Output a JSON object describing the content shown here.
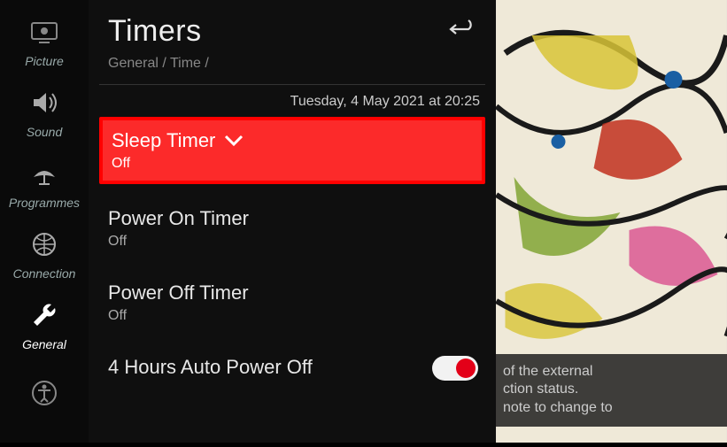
{
  "sidebar": {
    "items": [
      {
        "label": "Picture",
        "icon": "picture"
      },
      {
        "label": "Sound",
        "icon": "sound"
      },
      {
        "label": "Programmes",
        "icon": "programmes"
      },
      {
        "label": "Connection",
        "icon": "connection"
      },
      {
        "label": "General",
        "icon": "general",
        "active": true
      },
      {
        "label": "",
        "icon": "accessibility"
      }
    ]
  },
  "header": {
    "title": "Timers",
    "breadcrumb": "General / Time /",
    "datetime": "Tuesday, 4 May 2021 at 20:25"
  },
  "timers": {
    "sleep": {
      "label": "Sleep Timer",
      "value": "Off",
      "highlighted": true
    },
    "on": {
      "label": "Power On Timer",
      "value": "Off"
    },
    "off": {
      "label": "Power Off Timer",
      "value": "Off"
    },
    "auto4h": {
      "label": "4 Hours Auto Power Off",
      "toggle": true
    }
  },
  "overlay_hint": {
    "line1": "of the external",
    "line2": "ction status.",
    "line3": "note to change to"
  }
}
